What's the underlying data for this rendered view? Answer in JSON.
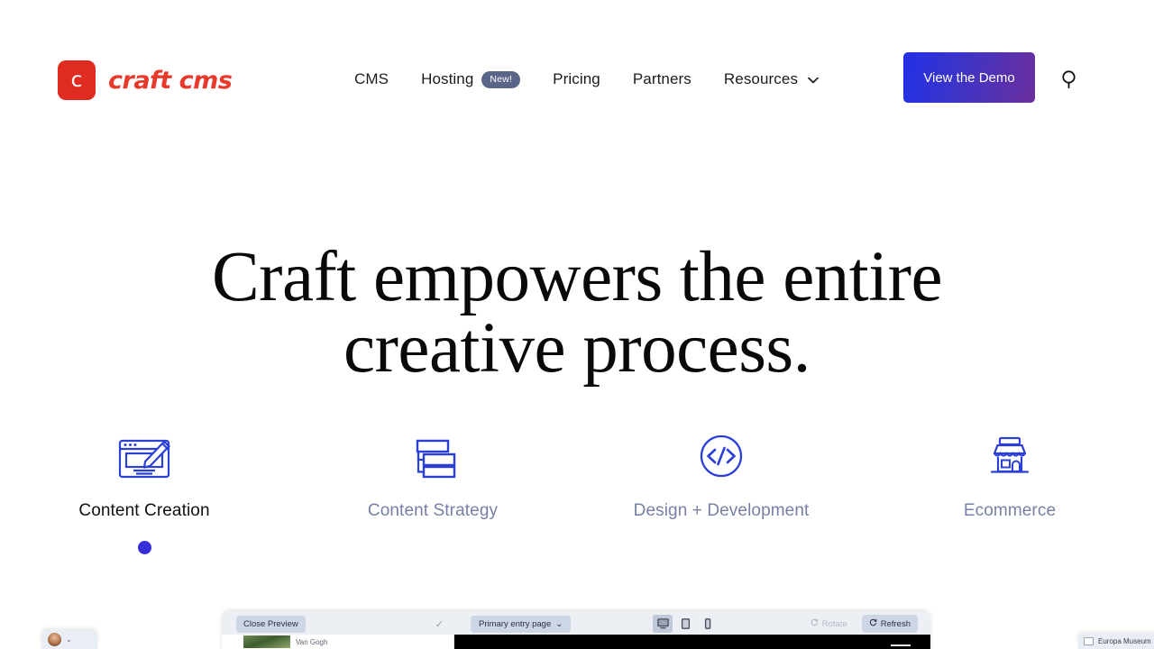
{
  "brand": {
    "mark_letter": "c",
    "name": "craft cms",
    "mark_color": "#E02B20",
    "text_color": "#E8392B"
  },
  "nav": {
    "items": [
      {
        "label": "CMS",
        "badge": null,
        "has_chevron": false
      },
      {
        "label": "Hosting",
        "badge": "New!",
        "has_chevron": false
      },
      {
        "label": "Pricing",
        "badge": null,
        "has_chevron": false
      },
      {
        "label": "Partners",
        "badge": null,
        "has_chevron": false
      },
      {
        "label": "Resources",
        "badge": null,
        "has_chevron": true
      }
    ],
    "chevron_glyph": "⌄",
    "badge_bg": "#5A6688"
  },
  "header": {
    "demo_button": "View the Demo",
    "demo_gradient_from": "#2330E6",
    "demo_gradient_to": "#6B2F9E",
    "search_icon": "search-icon"
  },
  "hero": {
    "line1": "Craft empowers the entire",
    "line2": "creative process."
  },
  "features": {
    "accent_color": "#2B3FD9",
    "active_dot_color": "#3730D8",
    "inactive_label_color": "#7781A6",
    "items": [
      {
        "label": "Content Creation",
        "icon": "browser-pencil-icon",
        "active": true
      },
      {
        "label": "Content Strategy",
        "icon": "sitemap-icon",
        "active": false
      },
      {
        "label": "Design + Development",
        "icon": "code-circle-icon",
        "active": false
      },
      {
        "label": "Ecommerce",
        "icon": "storefront-icon",
        "active": false
      }
    ]
  },
  "preview": {
    "close_button": "Close Preview",
    "check_glyph": "✓",
    "entry_select": "Primary entry page",
    "entry_chevron": "⌄",
    "devices": [
      {
        "name": "desktop",
        "active": true
      },
      {
        "name": "tablet",
        "active": false
      },
      {
        "name": "mobile",
        "active": false
      }
    ],
    "rotate_label": "Rotate",
    "rotate_icon": "rotate-icon",
    "refresh_label": "Refresh",
    "refresh_icon": "refresh-icon",
    "thumb_caption": "Van Gogh"
  },
  "chips": {
    "avatar_chevron": "⌄",
    "right_label": "Europa Museum"
  }
}
